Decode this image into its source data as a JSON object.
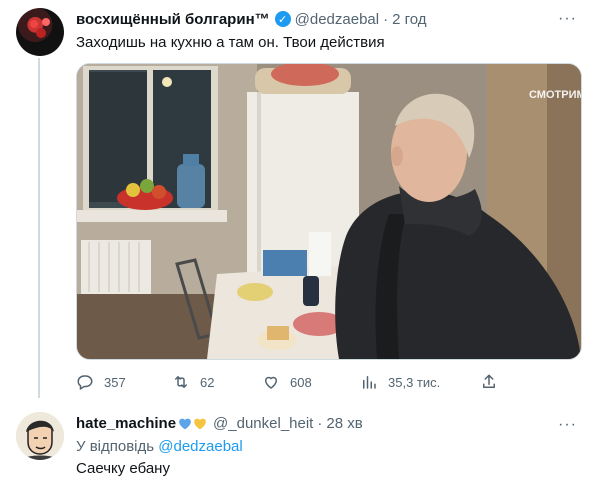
{
  "tweet": {
    "author_name": "восхищённый болгарин™",
    "author_handle": "@dedzaebal",
    "time": "2 год",
    "text": "Заходишь на кухню а там он. Твои действия",
    "media_watermark": "СМОТРИМ",
    "actions": {
      "replies": "357",
      "retweets": "62",
      "likes": "608",
      "views": "35,3 тис."
    }
  },
  "reply": {
    "author_name": "hate_machine",
    "author_handle": "@_dunkel_heit",
    "time": "28 хв",
    "replying_prefix": "У відповідь",
    "replying_to": "@dedzaebal",
    "text": "Саечку ебану"
  },
  "colors": {
    "accent": "#1d9bf0",
    "secondary_text": "#536471",
    "heart_blue": "#5da3e8",
    "heart_yellow": "#f5c542"
  },
  "icons": [
    "verified-badge-icon",
    "more-icon",
    "reply-icon",
    "retweet-icon",
    "like-icon",
    "views-icon",
    "share-icon",
    "blue-heart-icon",
    "yellow-heart-icon"
  ]
}
